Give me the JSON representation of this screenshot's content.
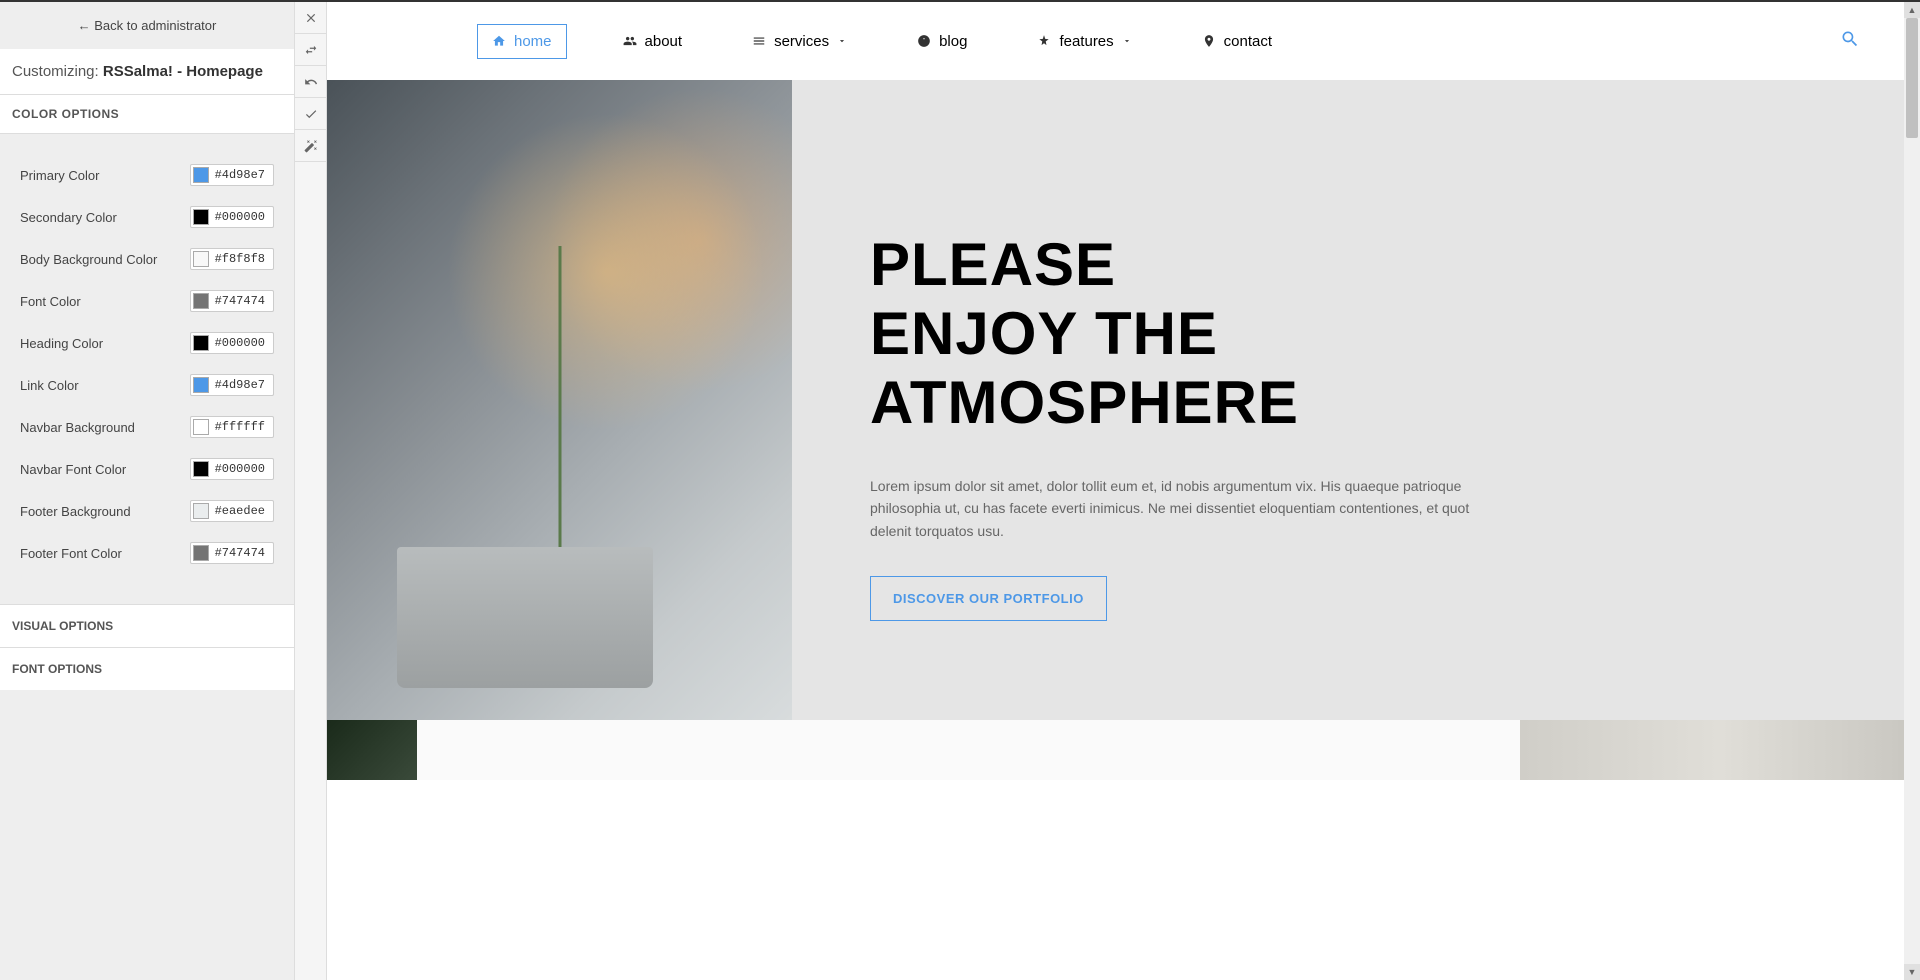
{
  "sidebar": {
    "back_link": "← Back to administrator",
    "customizing_prefix": "Customizing: ",
    "customizing_target": "RSSalma! - Homepage",
    "sections": {
      "color_header": "COLOR OPTIONS",
      "visual_header": "VISUAL OPTIONS",
      "font_header": "FONT OPTIONS"
    },
    "colors": [
      {
        "label": "Primary Color",
        "hex": "#4d98e7",
        "swatch": "#4d98e7"
      },
      {
        "label": "Secondary Color",
        "hex": "#000000",
        "swatch": "#000000"
      },
      {
        "label": "Body Background Color",
        "hex": "#f8f8f8",
        "swatch": "#f8f8f8"
      },
      {
        "label": "Font Color",
        "hex": "#747474",
        "swatch": "#747474"
      },
      {
        "label": "Heading Color",
        "hex": "#000000",
        "swatch": "#000000"
      },
      {
        "label": "Link Color",
        "hex": "#4d98e7",
        "swatch": "#4d98e7"
      },
      {
        "label": "Navbar Background",
        "hex": "#ffffff",
        "swatch": "#ffffff"
      },
      {
        "label": "Navbar Font Color",
        "hex": "#000000",
        "swatch": "#000000"
      },
      {
        "label": "Footer Background",
        "hex": "#eaedee",
        "swatch": "#eaedee"
      },
      {
        "label": "Footer Font Color",
        "hex": "#747474",
        "swatch": "#747474"
      }
    ]
  },
  "nav": {
    "items": [
      {
        "label": "home",
        "active": true
      },
      {
        "label": "about",
        "active": false
      },
      {
        "label": "services",
        "active": false,
        "caret": true
      },
      {
        "label": "blog",
        "active": false
      },
      {
        "label": "features",
        "active": false,
        "caret": true
      },
      {
        "label": "contact",
        "active": false
      }
    ]
  },
  "hero": {
    "title_l1": "PLEASE",
    "title_l2": "ENJOY THE",
    "title_l3": "ATMOSPHERE",
    "desc": "Lorem ipsum dolor sit amet, dolor tollit eum et, id nobis argumentum vix. His quaeque patrioque philosophia ut, cu has facete everti inimicus. Ne mei dissentiet eloquentiam contentiones, et quot delenit torquatos usu.",
    "cta": "DISCOVER OUR PORTFOLIO"
  }
}
